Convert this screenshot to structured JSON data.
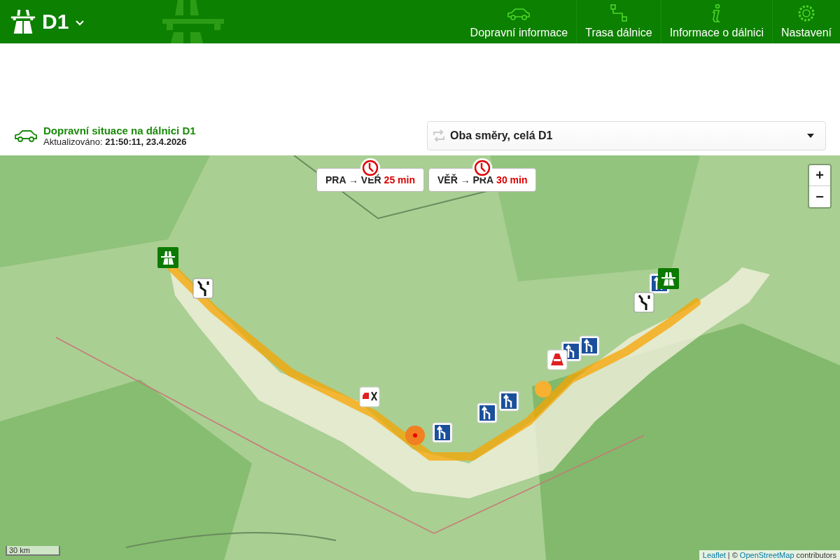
{
  "header": {
    "title": "D1"
  },
  "nav": [
    {
      "label": "Dopravní informace",
      "kind": "car"
    },
    {
      "label": "Trasa dálnice",
      "kind": "route"
    },
    {
      "label": "Informace o dálnici",
      "kind": "info"
    },
    {
      "label": "Nastavení",
      "kind": "gear"
    }
  ],
  "status": {
    "title": "Dopravní situace na dálnici D1",
    "updated_label": "Aktualizováno:",
    "updated_value": "21:50:11, 23.4.2026"
  },
  "direction_select": {
    "value": "Oba směry, celá D1"
  },
  "map": {
    "travel_times": [
      {
        "route": "PRA → VĚŘ",
        "duration": "25 min"
      },
      {
        "route": "VĚŘ → PRA",
        "duration": "30 min"
      }
    ],
    "zoom_in": "+",
    "zoom_out": "−",
    "scale": "30 km",
    "attribution_link1": "Leaflet",
    "attribution_sep": "| ©",
    "attribution_link2": "OpenStreetMap",
    "attribution_tail": "contributors"
  }
}
